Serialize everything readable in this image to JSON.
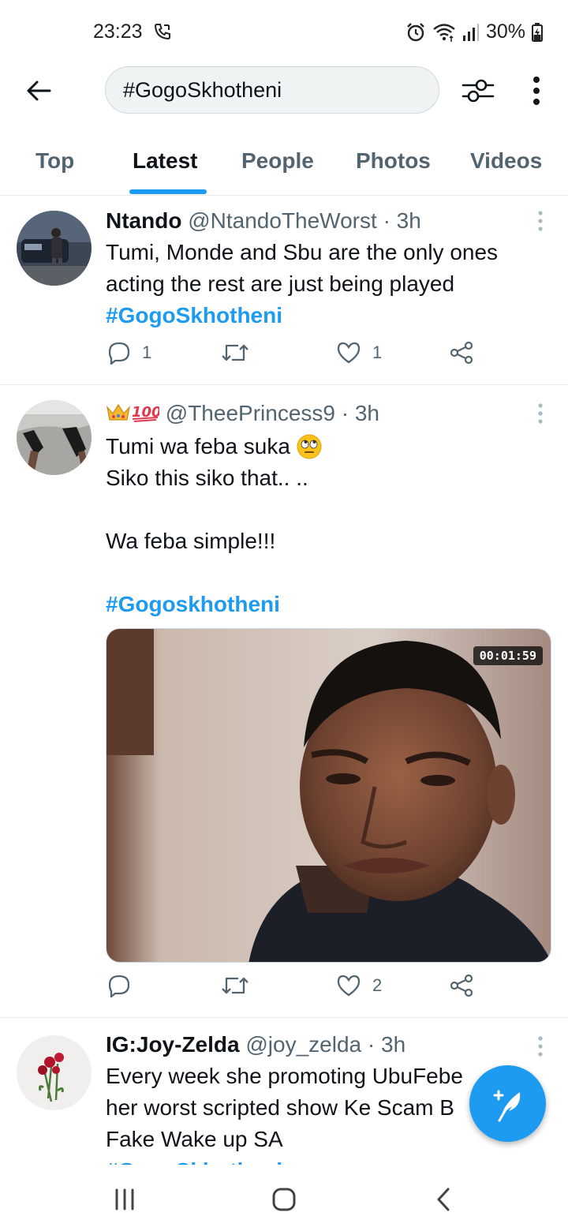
{
  "status_bar": {
    "time": "23:23",
    "battery": "30%",
    "icons": [
      "phone-call-icon",
      "alarm-icon",
      "wifi-icon",
      "signal-icon",
      "battery-charging-icon"
    ]
  },
  "search": {
    "query": "#GogoSkhotheni"
  },
  "tabs": [
    {
      "label": "Top",
      "active": false
    },
    {
      "label": "Latest",
      "active": true
    },
    {
      "label": "People",
      "active": false
    },
    {
      "label": "Photos",
      "active": false
    },
    {
      "label": "Videos",
      "active": false
    }
  ],
  "tweets": [
    {
      "name": "Ntando",
      "handle": "@NtandoTheWorst",
      "time": "3h",
      "lines": [
        "Tumi, Monde and Sbu are the only ones",
        "acting the rest are just being played"
      ],
      "hashtag": "#GogoSkhotheni",
      "replies": "1",
      "likes": "1"
    },
    {
      "name_emojis": [
        "crown-emoji",
        "hundred-points-emoji"
      ],
      "handle": "@TheePrincess9",
      "time": "3h",
      "lines": [
        "Tumi wa feba suka",
        "Siko this siko that.. ..",
        "",
        "Wa feba simple!!!",
        ""
      ],
      "hashtag": "#Gogoskhotheni",
      "media_duration": "00:01:59",
      "likes": "2"
    },
    {
      "name": "IG:Joy-Zelda",
      "handle": "@joy_zelda",
      "time": "3h",
      "lines": [
        "Every week she promoting UbuFebe",
        "her worst scripted show Ke Scam B",
        "Fake Wake up SA"
      ],
      "hashtag": "#GogoSkhotheni"
    }
  ],
  "colors": {
    "accent": "#1d9bf0",
    "text": "#0f1419",
    "secondary": "#536471",
    "divider": "#e6ecf0"
  }
}
